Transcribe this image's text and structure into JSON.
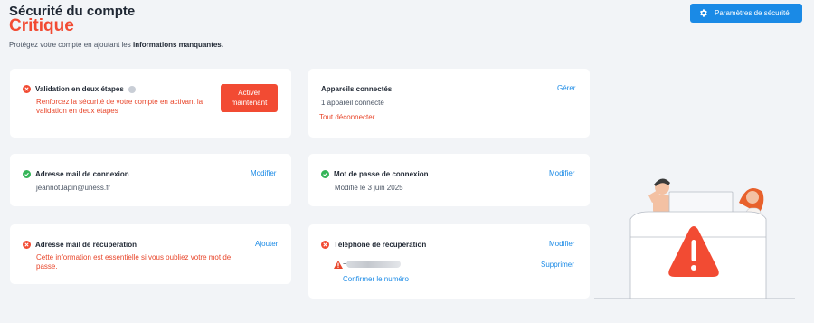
{
  "header": {
    "title": "Sécurité du compte",
    "status": "Critique",
    "subtitle_prefix": "Protégez votre compte en ajoutant les ",
    "subtitle_bold": "informations manquantes.",
    "settings_button": "Paramètres de sécurité"
  },
  "cards": {
    "two_step": {
      "title": "Validation en deux étapes",
      "description": "Renforcez la sécurité de votre compte en activant la validation en deux étapes",
      "action": "Activer maintenant",
      "status": "error"
    },
    "devices": {
      "title": "Appareils connectés",
      "count_text": "1 appareil connecté",
      "logout_all": "Tout déconnecter",
      "action": "Gérer"
    },
    "login_email": {
      "title": "Adresse mail de connexion",
      "value": "jeannot.lapin@uness.fr",
      "action": "Modifier",
      "status": "ok"
    },
    "password": {
      "title": "Mot de passe de connexion",
      "value": "Modifié le 3 juin 2025",
      "action": "Modifier",
      "status": "ok"
    },
    "recovery_email": {
      "title": "Adresse mail de récuperation",
      "description": "Cette information est essentielle si vous oubliez votre mot de passe.",
      "action": "Ajouter",
      "status": "error"
    },
    "recovery_phone": {
      "title": "Téléphone de récupération",
      "masked_prefix": "+",
      "confirm": "Confirmer le numéro",
      "action_edit": "Modifier",
      "action_delete": "Supprimer",
      "status": "error"
    }
  },
  "colors": {
    "critical": "#f24b33",
    "primary": "#1a8ae6",
    "success": "#35b558",
    "background": "#f2f4f7"
  },
  "icons": {
    "settings": "gear-icon",
    "error": "error-x-icon",
    "success": "check-icon",
    "info": "info-icon",
    "warning": "warning-triangle-icon"
  }
}
